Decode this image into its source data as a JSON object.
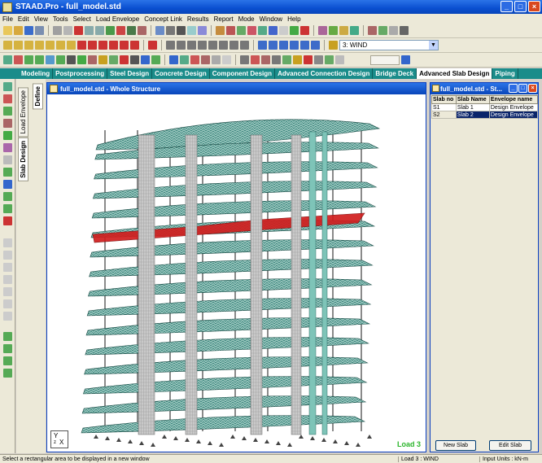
{
  "app": {
    "title": "STAAD.Pro - full_model.std"
  },
  "menu": [
    "File",
    "Edit",
    "View",
    "Tools",
    "Select",
    "Load Envelope",
    "Concept Link",
    "Results",
    "Report",
    "Mode",
    "Window",
    "Help"
  ],
  "toolbar": {
    "load_case": "3: WIND"
  },
  "page_tabs": [
    "Modeling",
    "Postprocessing",
    "Steel Design",
    "Concrete Design",
    "Component Design",
    "Advanced Connection Design",
    "Bridge Deck",
    "Advanced Slab Design",
    "Piping"
  ],
  "active_page_tab": "Advanced Slab Design",
  "side_tabs": {
    "load_envelope": "Load Envelope",
    "slab_design": "Slab Design",
    "define": "Define"
  },
  "main_window": {
    "title": "full_model.std - Whole Structure",
    "load_label": "Load 3"
  },
  "slab_window": {
    "title": "full_model.std - St...",
    "columns": [
      "Slab no",
      "Slab Name",
      "Envelope name"
    ],
    "rows": [
      [
        "S1",
        "Slab 1",
        "Design Envelope"
      ],
      [
        "S2",
        "Slab 2",
        "Design Envelope"
      ]
    ],
    "selected_row": 1,
    "new_button": "New Slab",
    "edit_button": "Edit Slab"
  },
  "status": {
    "message": "Select a rectangular area to be displayed in a new window",
    "load": "Load 3 : WIND",
    "units": "Input Units : kN-m"
  },
  "colors": {
    "slab_mesh": "#1f6b62",
    "highlighted_slab": "#d11e1e",
    "columns": "#c8c8c8",
    "accent_tab": "#1a8c8a"
  }
}
